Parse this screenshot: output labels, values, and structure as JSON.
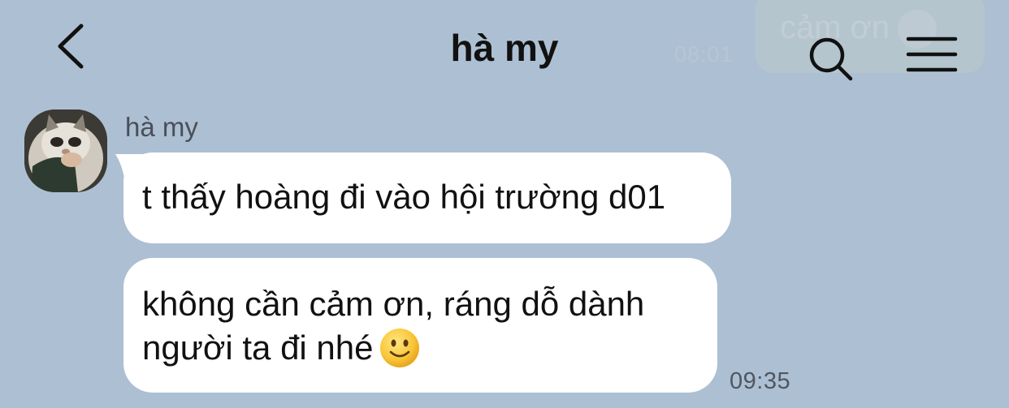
{
  "header": {
    "title": "hà my",
    "back_icon": "chevron-left-icon",
    "search_icon": "search-icon",
    "menu_icon": "menu-icon"
  },
  "background_preview": {
    "sent_message_text": "cảm ơn",
    "sent_time": "08:01"
  },
  "conversation": {
    "sender_name": "hà my",
    "messages": [
      {
        "text": "t thấy hoàng đi vào hội trường d01"
      },
      {
        "line1": "không cần cảm ơn, ráng dỗ dành",
        "line2": "người ta đi nhé",
        "emoji": "slightly-smiling-face"
      }
    ],
    "time": "09:35"
  },
  "colors": {
    "background": "#adbfd3",
    "bubble": "#ffffff",
    "text": "#111111"
  }
}
